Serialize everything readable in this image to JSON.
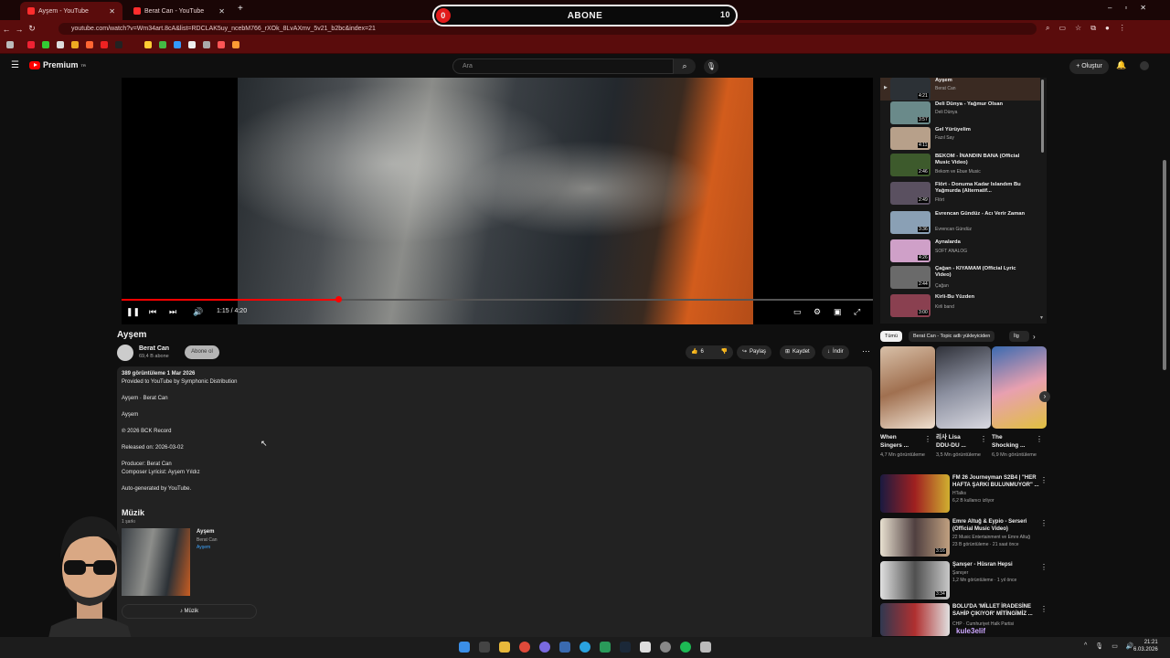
{
  "browser": {
    "tabs": [
      {
        "label": "Ayşem - YouTube"
      },
      {
        "label": "Berat Can - YouTube"
      }
    ],
    "url": "youtube.com/watch?v=Wm34art.8cA&list=RDCLAK5uy_ncebM766_rXOk_8LvAXmv_5v21_b2bc&index=21"
  },
  "overlay": {
    "label": "ABONE",
    "current": "0",
    "goal": "10"
  },
  "youtube": {
    "logo_text": "Premium",
    "logo_sup": "TR",
    "search_placeholder": "Ara",
    "create_label": "Oluştur"
  },
  "player": {
    "time": "1:15 / 4:20",
    "progress_fraction": 0.288
  },
  "video": {
    "title": "Ayşem",
    "channel": "Berat Can",
    "subscribers": "69,4 B abone",
    "subscribe_label": "Abone ol",
    "likes": "6",
    "share_label": "Paylaş",
    "save_label": "Kaydet",
    "download_label": "İndir"
  },
  "description": {
    "line1": "389 görüntüleme  1 Mar 2026",
    "line2": "Provided to YouTube by Symphonic Distribution",
    "line3": "Ayşem · Berat Can",
    "line4": "Ayşem",
    "line5": "℗ 2026 BCK Record",
    "line6": "Released on: 2026-03-02",
    "line7": "Producer: Berat Can",
    "line8": "Composer Lyricist: Ayşem Yıldız",
    "line9": "Auto-generated by YouTube."
  },
  "music": {
    "heading": "Müzik",
    "count": "1 şarkı",
    "song": "Ayşem",
    "artist": "Berat Can",
    "album": "Ayşem",
    "button": "Müzik"
  },
  "playlist": [
    {
      "title": "Ayşem",
      "channel": "Berat Can",
      "duration": "4:21"
    },
    {
      "title": "Deli Dünya - Yağmur Olsan",
      "channel": "Deli Dünya",
      "duration": "3:57"
    },
    {
      "title": "Gel Yürüyelim",
      "channel": "Fazıl Say",
      "duration": "4:11"
    },
    {
      "title": "BEKOM - İNANDIN BANA (Official Music Video)",
      "channel": "Bekom ve Ebue Music",
      "duration": "2:46"
    },
    {
      "title": "Flört - Donuma Kadar Islandım Bu Yağmurda (Alternatif...",
      "channel": "Flört",
      "duration": "2:49"
    },
    {
      "title": "Evrencan Gündüz - Acı Verir Zaman",
      "channel": "Evrencan Gündüz",
      "duration": "3:36"
    },
    {
      "title": "Aynalarda",
      "channel": "SOFT ANALOG",
      "duration": "4:26"
    },
    {
      "title": "Çağan - KIYAMAM (Official Lyric Video)",
      "channel": "Çağan",
      "duration": "2:44"
    },
    {
      "title": "Kirli-Bu Yüzden",
      "channel": "Kirli band",
      "duration": "3:00"
    }
  ],
  "chips": [
    "Tümü",
    "Berat Can - Topic adlı yükleyiciden",
    "İlg"
  ],
  "shorts": [
    {
      "title": "When Singers ...",
      "views": "4,7 Mn görüntüleme"
    },
    {
      "title": "리사 Lisa DDU-DU ...",
      "views": "3,5 Mn görüntüleme"
    },
    {
      "title": "The Shocking ...",
      "views": "6,9 Mn görüntüleme"
    }
  ],
  "recommended": [
    {
      "title": "FM 26 Journeyman S2B4 | \"HER HAFTA ŞARKI BULUNMUYOR\" ...",
      "channel": "HTalks",
      "meta": "6,2 B kullanıcı izliyor",
      "duration": ""
    },
    {
      "title": "Emre Altuğ & Eypio - Serseri (Official Music Video)",
      "channel": "22 Music Entertainment ve Emre Altuğ",
      "meta": "23 B görüntüleme · 21 saat önce",
      "duration": "3:16"
    },
    {
      "title": "Şanışer - Hüsran Hepsi",
      "channel": "Şanışer",
      "meta": "1,2 Mn görüntüleme · 1 yıl önce",
      "duration": "3:34"
    },
    {
      "title": "BOLU'DA 'MİLLET İRADESİNE SAHİP ÇIKIYOR' MİTİNGİMİZ ...",
      "channel": "CHP · Cumhuriyet Halk Partisi",
      "meta": "",
      "duration": ""
    }
  ],
  "streamer_tag": "kule3elif",
  "clock": {
    "time": "21:21",
    "date": "6.03.2026"
  },
  "colors": {
    "accent": "#ff0000",
    "browser_frame": "#5a0c0c"
  }
}
